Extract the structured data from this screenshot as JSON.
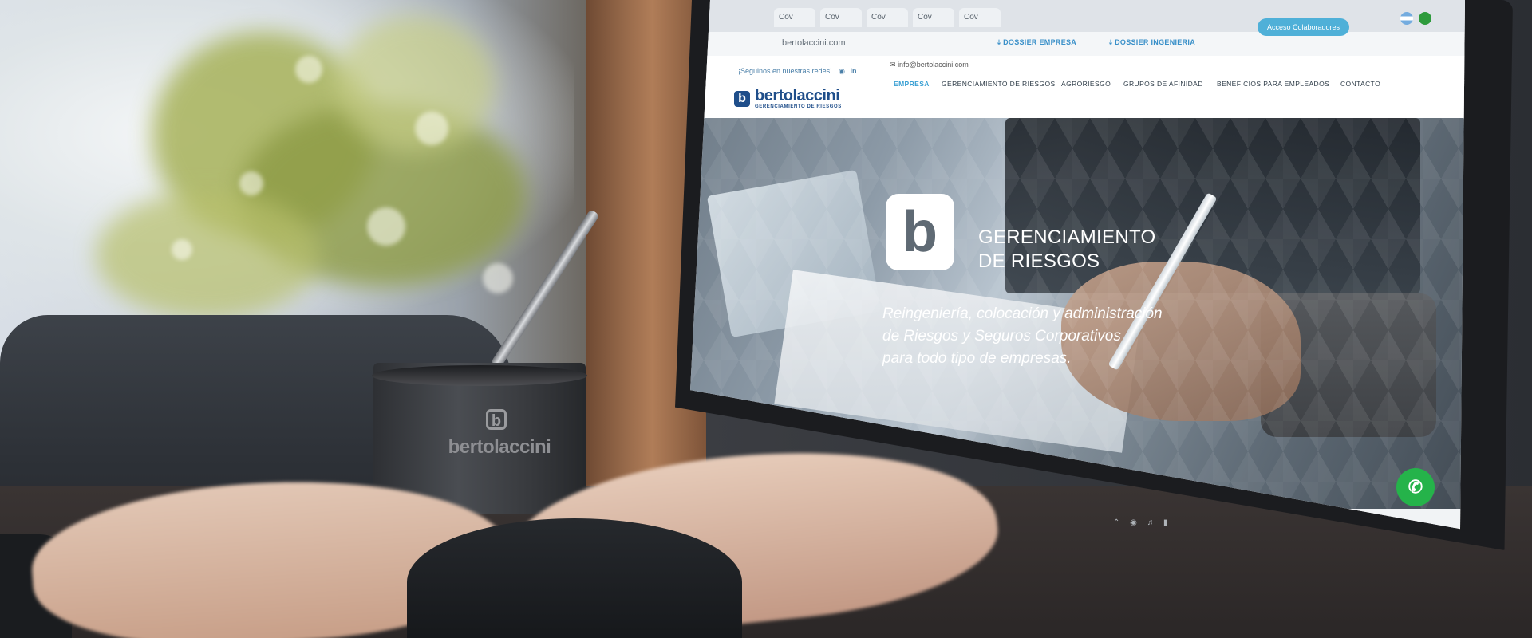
{
  "cup": {
    "logo_letter": "b",
    "brand": "bertolaccini"
  },
  "browser": {
    "tabs": [
      "Cov",
      "Cov",
      "Cov",
      "Cov",
      "Cov"
    ],
    "url": "bertolaccini.com"
  },
  "site": {
    "social_text": "¡Seguinos en nuestras redes!",
    "social_icons": [
      "instagram-icon",
      "linkedin-icon"
    ],
    "email": "info@bertolaccini.com",
    "dossier_empresa": "DOSSIER EMPRESA",
    "dossier_ingenieria": "DOSSIER INGENIERIA",
    "access_button": "Acceso Colaboradores",
    "logo_name": "bertolaccini",
    "logo_sub": "GERENCIAMIENTO DE RIESGOS",
    "nav": [
      "EMPRESA",
      "GERENCIAMIENTO DE RIESGOS",
      "AGRORIESGO",
      "GRUPOS DE AFINIDAD",
      "BENEFICIOS PARA EMPLEADOS",
      "CONTACTO"
    ],
    "hero_title_line1": "GERENCIAMIENTO",
    "hero_title_line2": "DE RIESGOS",
    "hero_tagline_1": "Reingeniería, colocación y administración",
    "hero_tagline_2": "de Riesgos y Seguros Corporativos",
    "hero_tagline_3": "para todo tipo de empresas."
  },
  "colors": {
    "brand_blue": "#1f4e8a",
    "accent_cyan": "#3aa0d4",
    "whatsapp_green": "#25b34a"
  }
}
